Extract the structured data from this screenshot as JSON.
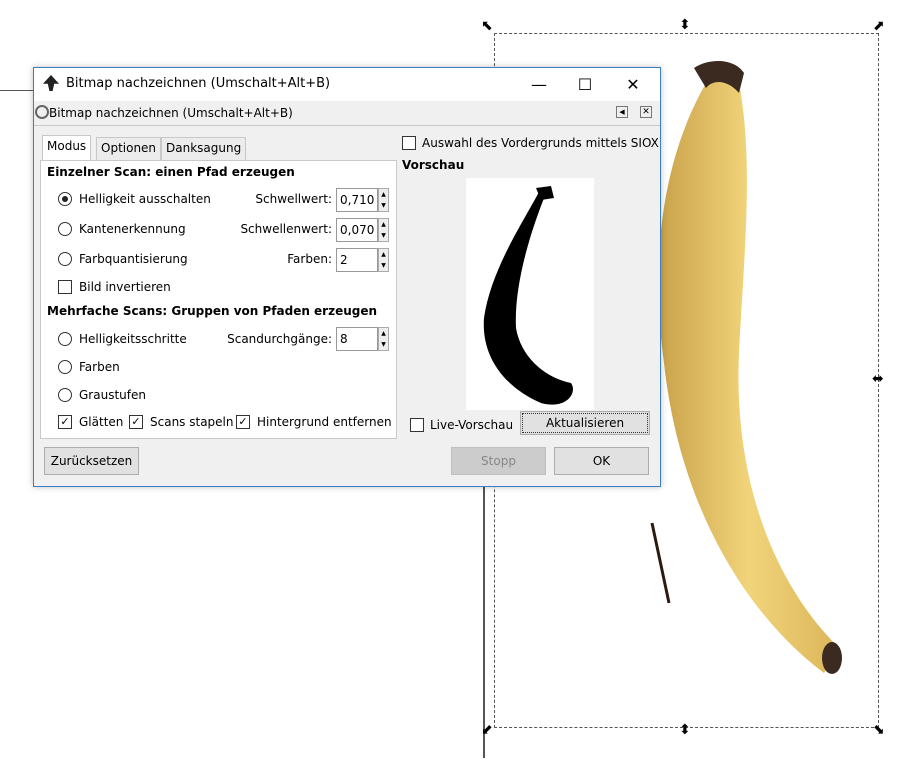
{
  "window": {
    "title": "Bitmap nachzeichnen (Umschalt+Alt+B)",
    "minimize": "—",
    "maximize": "☐",
    "close": "✕"
  },
  "dock": {
    "title": "Bitmap nachzeichnen (Umschalt+Alt+B)"
  },
  "tabs": [
    "Modus",
    "Optionen",
    "Danksagung"
  ],
  "single": {
    "heading": "Einzelner Scan: einen Pfad erzeugen",
    "options": [
      {
        "label": "Helligkeit ausschalten",
        "param": "Schwellwert:",
        "value": "0,710",
        "selected": true
      },
      {
        "label": "Kantenerkennung",
        "param": "Schwellenwert:",
        "value": "0,070",
        "selected": false
      },
      {
        "label": "Farbquantisierung",
        "param": "Farben:",
        "value": "2",
        "selected": false
      }
    ],
    "invert": {
      "label": "Bild invertieren",
      "checked": false
    }
  },
  "multi": {
    "heading": "Mehrfache Scans: Gruppen von Pfaden erzeugen",
    "options": [
      {
        "label": "Helligkeitsschritte",
        "selected": false
      },
      {
        "label": "Farben",
        "selected": false
      },
      {
        "label": "Graustufen",
        "selected": false
      }
    ],
    "scans_label": "Scandurchgänge:",
    "scans_value": "8",
    "checks": [
      {
        "label": "Glätten",
        "checked": true
      },
      {
        "label": "Scans stapeln",
        "checked": true
      },
      {
        "label": "Hintergrund entfernen",
        "checked": true
      }
    ]
  },
  "siox": {
    "label": "Auswahl des Vordergrunds mittels SIOX",
    "checked": false
  },
  "preview": {
    "heading": "Vorschau",
    "live_label": "Live-Vorschau",
    "live_checked": false,
    "update_button": "Aktualisieren"
  },
  "buttons": {
    "reset": "Zurücksetzen",
    "stop": "Stopp",
    "ok": "OK"
  }
}
